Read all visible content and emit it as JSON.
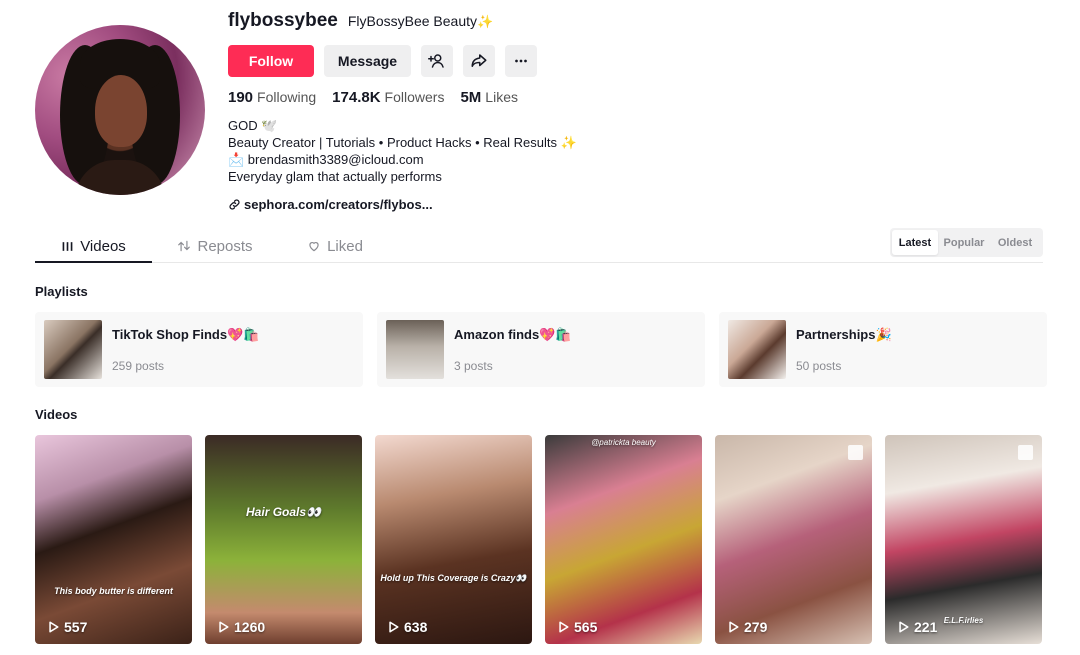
{
  "profile": {
    "username": "flybossybee",
    "display_name": "FlyBossyBee Beauty",
    "display_name_emoji": "✨",
    "follow_label": "Follow",
    "message_label": "Message",
    "stats": {
      "following_count": "190",
      "following_label": "Following",
      "followers_count": "174.8K",
      "followers_label": "Followers",
      "likes_count": "5M",
      "likes_label": "Likes"
    },
    "bio": {
      "line1": "GOD 🕊️",
      "line2": "Beauty Creator | Tutorials • Product Hacks • Real Results ✨",
      "line3": "📩 brendasmith3389@icloud.com",
      "line4": "Everyday glam that actually performs"
    },
    "link": "sephora.com/creators/flybos..."
  },
  "tabs": [
    {
      "label": "Videos",
      "icon": "grid-icon",
      "active": true
    },
    {
      "label": "Reposts",
      "icon": "repost-icon",
      "active": false
    },
    {
      "label": "Liked",
      "icon": "heart-icon",
      "active": false
    }
  ],
  "sort": {
    "latest": "Latest",
    "popular": "Popular",
    "oldest": "Oldest",
    "selected": "Latest"
  },
  "playlists_title": "Playlists",
  "playlists": [
    {
      "name": "TikTok Shop Finds💖🛍️",
      "count": "259 posts"
    },
    {
      "name": "Amazon finds💖🛍️",
      "count": "3 posts"
    },
    {
      "name": "Partnerships🎉",
      "count": "50 posts"
    }
  ],
  "videos_title": "Videos",
  "videos": [
    {
      "plays": "557",
      "overlay": "This body butter is different"
    },
    {
      "plays": "1260",
      "overlay": "Hair Goals👀"
    },
    {
      "plays": "638",
      "overlay": "Hold up This Coverage is Crazy👀"
    },
    {
      "plays": "565",
      "overlay": "@patrickta beauty"
    },
    {
      "plays": "279",
      "overlay": ""
    },
    {
      "plays": "221",
      "overlay": "E.L.F.irlies"
    }
  ],
  "colors": {
    "accent": "#fe2c55",
    "text": "#161823",
    "muted": "#8a8b91"
  }
}
